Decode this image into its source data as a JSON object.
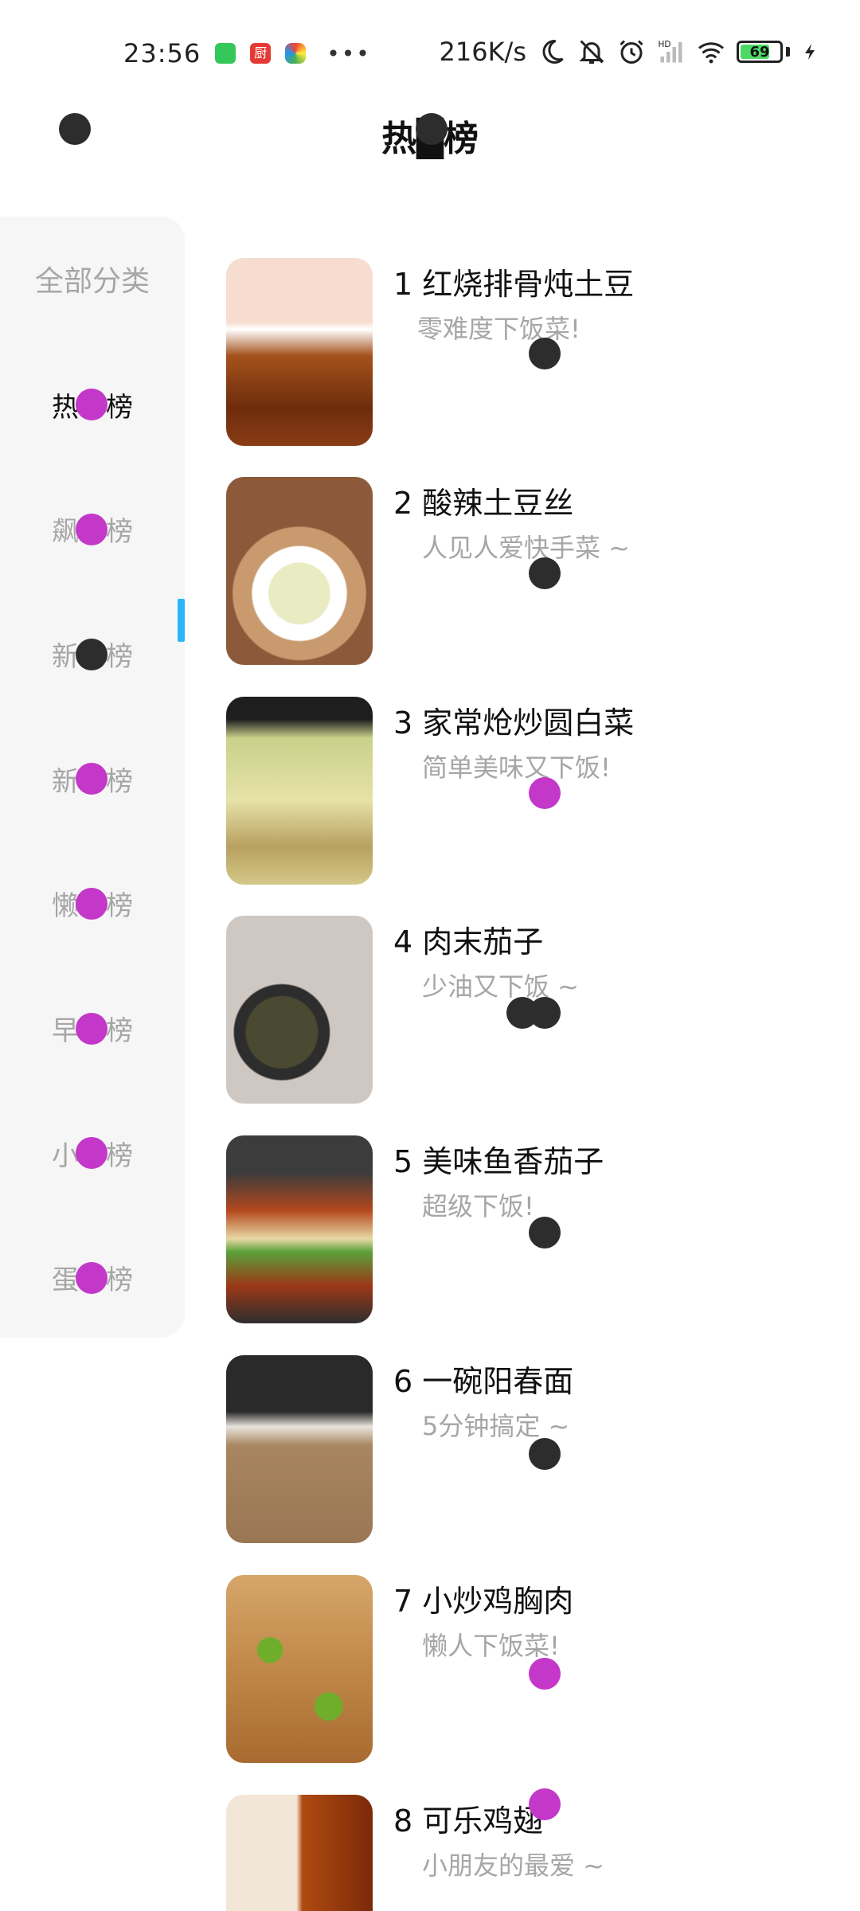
{
  "status_bar": {
    "time": "23:56",
    "network_speed": "216K/s",
    "battery_level": "69",
    "battery_percent": 69,
    "app_badge_red": "厨",
    "more": "•••"
  },
  "header": {
    "title": "热█榜"
  },
  "sidebar": {
    "header": "全部分类",
    "items": [
      {
        "left": "热",
        "right": "榜",
        "active": true
      },
      {
        "left": "飙",
        "right": "榜",
        "active": false
      },
      {
        "left": "新",
        "right": "榜",
        "active": false
      },
      {
        "left": "新",
        "right": "榜",
        "active": false
      },
      {
        "left": "懒",
        "right": "榜",
        "active": false
      },
      {
        "left": "早",
        "right": "榜",
        "active": false
      },
      {
        "left": "小",
        "right": "榜",
        "active": false
      },
      {
        "left": "蛋",
        "right": "榜",
        "active": false
      }
    ]
  },
  "recipes": [
    {
      "title": "1 红烧排骨炖土豆",
      "desc": "零难度下饭菜!"
    },
    {
      "title": "2 酸辣土豆丝",
      "desc": "人见人爱快手菜 ~"
    },
    {
      "title": "3 家常炝炒圆白菜",
      "desc": "简单美味又下饭!"
    },
    {
      "title": "4 肉末茄子",
      "desc": "少油又下饭 ~"
    },
    {
      "title": "5 美味鱼香茄子",
      "desc": "超级下饭!"
    },
    {
      "title": "6 一碗阳春面",
      "desc": "5分钟搞定 ~"
    },
    {
      "title": "7 小炒鸡胸肉",
      "desc": "懒人下饭菜!"
    },
    {
      "title": "8 可乐鸡翅",
      "desc": "小朋友的最爱 ~"
    }
  ],
  "colors": {
    "accent": "#29b6f6",
    "marker_dark": "#2d2d2d",
    "marker_magenta": "#c338c8"
  }
}
